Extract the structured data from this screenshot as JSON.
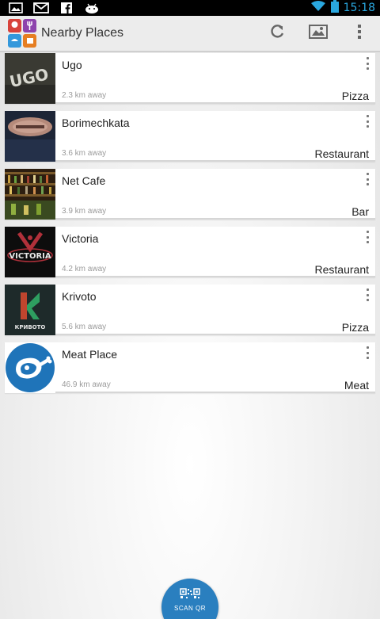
{
  "status_bar": {
    "time": "15:18",
    "icons": [
      "image-icon",
      "gmail-icon",
      "facebook-icon",
      "android-icon"
    ],
    "time_color": "#2aa8e0"
  },
  "app_bar": {
    "title": "Nearby Places",
    "actions": [
      "refresh-icon",
      "map-icon",
      "overflow-menu-icon"
    ]
  },
  "places": [
    {
      "name": "Ugo",
      "distance": "2.3 km away",
      "category": "Pizza",
      "thumb_text": "UGO"
    },
    {
      "name": "Borimechkata",
      "distance": "3.6 km away",
      "category": "Restaurant",
      "thumb_text": ""
    },
    {
      "name": "Net Cafe",
      "distance": "3.9 km away",
      "category": "Bar",
      "thumb_text": ""
    },
    {
      "name": "Victoria",
      "distance": "4.2 km away",
      "category": "Restaurant",
      "thumb_text": "VICTORIA"
    },
    {
      "name": "Krivoto",
      "distance": "5.6 km away",
      "category": "Pizza",
      "thumb_text": "КРИВОТО"
    },
    {
      "name": "Meat Place",
      "distance": "46.9 km away",
      "category": "Meat",
      "thumb_text": ""
    }
  ],
  "scan_button": {
    "label": "SCAN QR",
    "color": "#2a7fbf"
  }
}
